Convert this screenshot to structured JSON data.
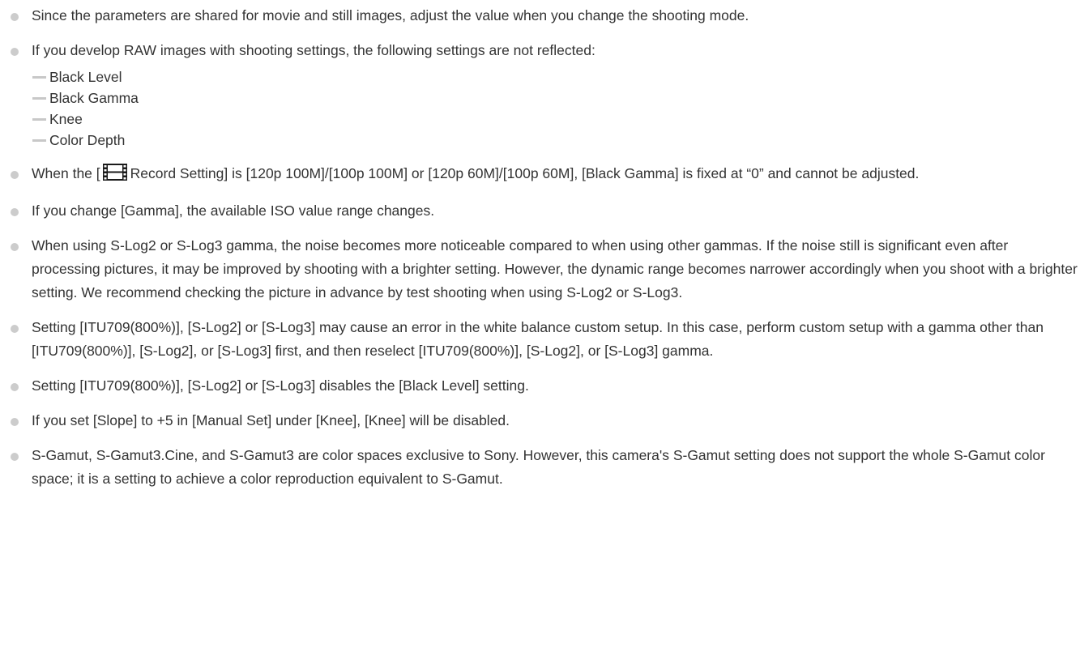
{
  "notes": [
    {
      "text": "Since the parameters are shared for movie and still images, adjust the value when you change the shooting mode."
    },
    {
      "text": "If you develop RAW images with shooting settings, the following settings are not reflected:",
      "subitems": [
        "Black Level",
        "Black Gamma",
        "Knee",
        "Color Depth"
      ]
    },
    {
      "before_icon": "When the [",
      "icon": "movie-icon",
      "after_icon": "Record Setting] is [120p 100M]/[100p 100M] or [120p 60M]/[100p 60M], [Black Gamma] is fixed at “0” and cannot be adjusted."
    },
    {
      "text": "If you change [Gamma], the available ISO value range changes."
    },
    {
      "text": "When using S-Log2 or S-Log3 gamma, the noise becomes more noticeable compared to when using other gammas. If the noise still is significant even after processing pictures, it may be improved by shooting with a brighter setting. However, the dynamic range becomes narrower accordingly when you shoot with a brighter setting. We recommend checking the picture in advance by test shooting when using S-Log2 or S-Log3."
    },
    {
      "text": "Setting [ITU709(800%)], [S-Log2] or [S-Log3] may cause an error in the white balance custom setup. In this case, perform custom setup with a gamma other than [ITU709(800%)], [S-Log2], or [S-Log3] first, and then reselect [ITU709(800%)], [S-Log2], or [S-Log3] gamma."
    },
    {
      "text": "Setting [ITU709(800%)], [S-Log2] or [S-Log3] disables the [Black Level] setting."
    },
    {
      "text": "If you set [Slope] to +5 in [Manual Set] under [Knee], [Knee] will be disabled."
    },
    {
      "text": "S-Gamut, S-Gamut3.Cine, and S-Gamut3 are color spaces exclusive to Sony. However, this camera's S-Gamut setting does not support the whole S-Gamut color space; it is a setting to achieve a color reproduction equivalent to S-Gamut."
    }
  ],
  "colors": {
    "text": "#333333",
    "bullet": "#cccccc",
    "dash": "#c8c8c8"
  }
}
